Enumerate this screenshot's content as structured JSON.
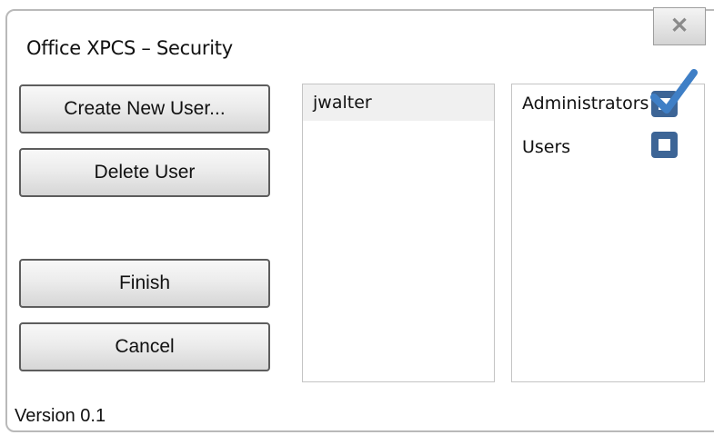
{
  "window": {
    "title": "Office XPCS – Security",
    "close_label": "✕"
  },
  "actions": {
    "create_user": "Create New User...",
    "delete_user": "Delete User",
    "finish": "Finish",
    "cancel": "Cancel"
  },
  "users": [
    {
      "name": "jwalter",
      "selected": true
    }
  ],
  "groups": [
    {
      "label": "Administrators",
      "checked": true
    },
    {
      "label": "Users",
      "checked": false
    }
  ],
  "footer": {
    "version": "Version 0.1"
  },
  "colors": {
    "checkbox": "#3d6596",
    "checkmark": "#3f7fc6"
  }
}
